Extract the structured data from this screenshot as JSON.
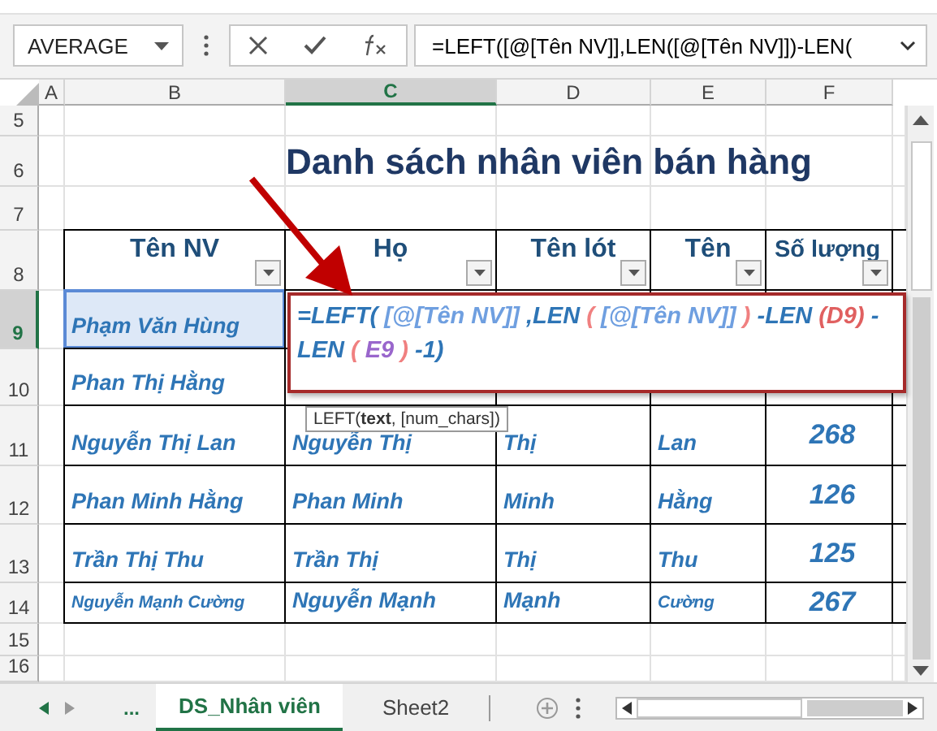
{
  "formula_bar": {
    "name_box": "AVERAGE",
    "formula": "=LEFT([@[Tên NV]],LEN([@[Tên NV]])-LEN("
  },
  "columns": [
    {
      "letter": "A",
      "selected": false
    },
    {
      "letter": "B",
      "selected": false
    },
    {
      "letter": "C",
      "selected": true
    },
    {
      "letter": "D",
      "selected": false
    },
    {
      "letter": "E",
      "selected": false
    },
    {
      "letter": "F",
      "selected": false
    }
  ],
  "rows": [
    {
      "number": "5",
      "selected": false
    },
    {
      "number": "6",
      "selected": false
    },
    {
      "number": "7",
      "selected": false
    },
    {
      "number": "8",
      "selected": false
    },
    {
      "number": "9",
      "selected": true
    },
    {
      "number": "10",
      "selected": false
    },
    {
      "number": "11",
      "selected": false
    },
    {
      "number": "12",
      "selected": false
    },
    {
      "number": "13",
      "selected": false
    },
    {
      "number": "14",
      "selected": false
    },
    {
      "number": "15",
      "selected": false
    },
    {
      "number": "16",
      "selected": false
    }
  ],
  "title": "Danh sách nhân viên bán hàng",
  "table": {
    "headers": [
      "Tên NV",
      "Họ",
      "Tên lót",
      "Tên",
      "Số lượng"
    ],
    "rows": [
      {
        "cells": [
          {
            "text": "Phạm Văn Hùng",
            "shrink": false,
            "selected": true
          }
        ]
      },
      {
        "cells": [
          {
            "text": "Phan Thị Hằng",
            "shrink": false,
            "selected": false
          }
        ]
      },
      {
        "cells": [
          {
            "text": "Nguyễn Thị Lan",
            "shrink": false,
            "selected": false
          },
          {
            "text": "Nguyễn Thị",
            "shrink": false,
            "selected": false
          },
          {
            "text": "Thị",
            "shrink": false,
            "selected": false
          },
          {
            "text": "Lan",
            "shrink": false,
            "selected": false
          },
          {
            "text": "268",
            "shrink": false,
            "selected": false
          }
        ]
      },
      {
        "cells": [
          {
            "text": "Phan Minh Hằng",
            "shrink": false,
            "selected": false
          },
          {
            "text": "Phan Minh",
            "shrink": false,
            "selected": false
          },
          {
            "text": "Minh",
            "shrink": false,
            "selected": false
          },
          {
            "text": "Hằng",
            "shrink": false,
            "selected": false
          },
          {
            "text": "126",
            "shrink": false,
            "selected": false
          }
        ]
      },
      {
        "cells": [
          {
            "text": "Trần Thị Thu",
            "shrink": false,
            "selected": false
          },
          {
            "text": "Trần Thị",
            "shrink": false,
            "selected": false
          },
          {
            "text": "Thị",
            "shrink": false,
            "selected": false
          },
          {
            "text": "Thu",
            "shrink": false,
            "selected": false
          },
          {
            "text": "125",
            "shrink": false,
            "selected": false
          }
        ]
      },
      {
        "cells": [
          {
            "text": "Nguyễn Mạnh Cường",
            "shrink": true,
            "selected": false
          },
          {
            "text": "Nguyễn Mạnh",
            "shrink": false,
            "selected": false
          },
          {
            "text": "Mạnh",
            "shrink": false,
            "selected": false
          },
          {
            "text": "Cường",
            "shrink": true,
            "selected": false
          },
          {
            "text": "267",
            "shrink": false,
            "selected": false
          }
        ]
      }
    ]
  },
  "cell_editor": {
    "lines": [
      [
        {
          "text": "=LEFT(",
          "color": "#2e75b6"
        },
        {
          "text": " [@[Tên NV]]",
          "color": "#6f9fe0"
        },
        {
          "text": " ,LEN",
          "color": "#2e75b6"
        },
        {
          "text": " ( ",
          "color": "#f08080"
        },
        {
          "text": "[@[Tên NV]]",
          "color": "#6f9fe0"
        },
        {
          "text": " ) ",
          "color": "#f08080"
        },
        {
          "text": "-LEN ",
          "color": "#2e75b6"
        },
        {
          "text": "(D9)",
          "color": "#e06060"
        },
        {
          "text": " -",
          "color": "#2e75b6"
        }
      ],
      [
        {
          "text": "LEN ",
          "color": "#2e75b6"
        },
        {
          "text": "( ",
          "color": "#f08080"
        },
        {
          "text": "E9",
          "color": "#9966cc"
        },
        {
          "text": " ) ",
          "color": "#f08080"
        },
        {
          "text": "-1)",
          "color": "#2e75b6"
        }
      ]
    ]
  },
  "tooltip": "LEFT(**text**, [num_chars])",
  "sheet_tabs": {
    "more": "...",
    "tabs": [
      {
        "label": "DS_Nhân viên",
        "selected": true
      },
      {
        "label": "Sheet2",
        "selected": false
      }
    ]
  }
}
